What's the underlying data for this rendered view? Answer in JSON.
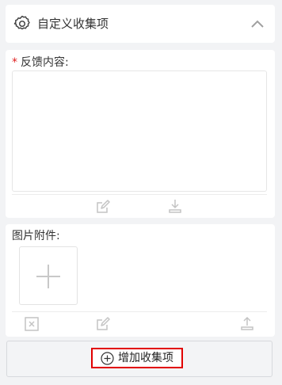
{
  "header": {
    "title": "自定义收集项",
    "icon": "gear-icon",
    "toggle_icon": "chevron-up-icon"
  },
  "feedback": {
    "required_mark": "*",
    "label": "反馈内容:",
    "value": "",
    "tools": [
      "edit-icon",
      "download-icon"
    ]
  },
  "attachments": {
    "label": "图片附件:",
    "upload_icon": "plus-icon",
    "tools": [
      "delete-icon",
      "edit-icon",
      "upload-icon"
    ]
  },
  "add_button": {
    "label": "增加收集项",
    "icon": "plus-circle-icon"
  },
  "colors": {
    "required": "#e02020",
    "icon_gray": "#c4c4c4",
    "highlight": "#e10000"
  }
}
